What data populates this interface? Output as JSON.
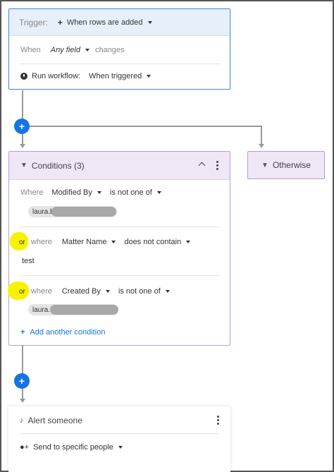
{
  "trigger": {
    "label": "Trigger:",
    "event_label": "When rows are added",
    "when_label": "When",
    "field_value": "Any field",
    "changes_label": "changes",
    "run_label": "Run workflow:",
    "run_value": "When triggered"
  },
  "connectors": {
    "add_symbol": "+"
  },
  "conditions": {
    "title": "Conditions (3)",
    "rows": [
      {
        "prefix": "Where",
        "field": "Modified By",
        "operator": "is not one of",
        "chip_text": "laura.b"
      },
      {
        "or_label": "or",
        "prefix": "where",
        "field": "Matter Name",
        "operator": "does not contain",
        "value": "test"
      },
      {
        "or_label": "or",
        "prefix": "where",
        "field": "Created By",
        "operator": "is not one of",
        "chip_text": "laura."
      }
    ],
    "add_condition_label": "Add another condition"
  },
  "otherwise": {
    "label": "Otherwise"
  },
  "alert": {
    "title": "Alert someone",
    "send_label": "Send to specific people"
  },
  "icons": {
    "funnel": "filter-icon",
    "bell": "bell-icon",
    "clock": "clock-icon",
    "people": "add-person-icon"
  },
  "colors": {
    "trigger_border": "#4a90d9",
    "trigger_header": "#e6f0fb",
    "condition_border": "#b89cd0",
    "condition_header": "#efe6f6",
    "accent_blue": "#1473e6",
    "highlight_yellow": "#f7f300"
  }
}
